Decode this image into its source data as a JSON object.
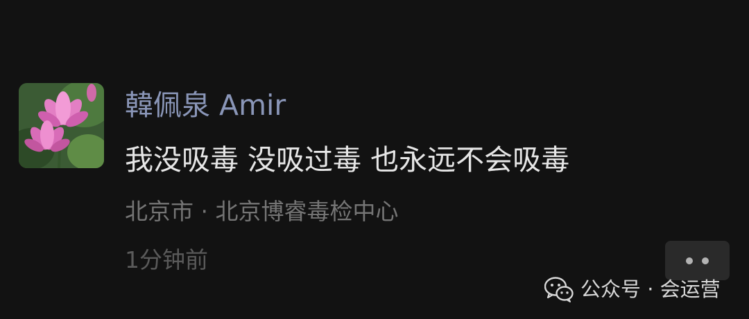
{
  "post": {
    "username": "韓佩泉 Amir",
    "content": "我没吸毒 没吸过毒 也永远不会吸毒",
    "location": "北京市 · 北京博睿毒检中心",
    "time": "1分钟前"
  },
  "avatar": {
    "icon": "lotus-flower-avatar"
  },
  "more_button": {
    "icon": "more-dots-icon"
  },
  "watermark": {
    "icon": "wechat-logo-icon",
    "text": "公众号 · 会运营"
  },
  "colors": {
    "background": "#121212",
    "username": "#8a96b8",
    "content": "#e6e6e6",
    "meta": "#757575"
  }
}
